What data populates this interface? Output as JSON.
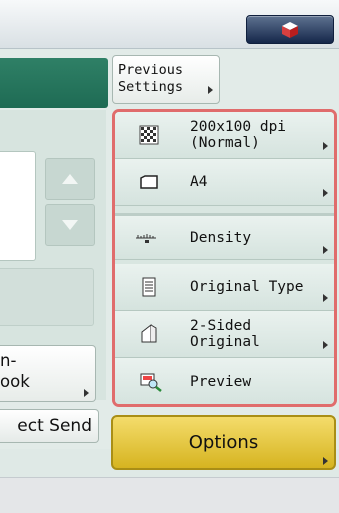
{
  "header": {
    "status_icon": "cube-monitor-icon"
  },
  "left_panel": {
    "address_book_line1": "n-",
    "address_book_line2": "ook",
    "direct_send_label": "ect Send"
  },
  "previous_settings": {
    "line1": "Previous",
    "line2": "Settings"
  },
  "settings": [
    {
      "line1": "200x100 dpi",
      "line2": "(Normal)",
      "icon": "resolution-icon"
    },
    {
      "line1": "A4",
      "line2": "",
      "icon": "paper-size-icon"
    },
    {
      "line1": "Density",
      "line2": "",
      "icon": "density-icon"
    },
    {
      "line1": "Original Type",
      "line2": "",
      "icon": "original-type-icon"
    },
    {
      "line1": "2-Sided",
      "line2": "Original",
      "icon": "two-sided-icon"
    },
    {
      "line1": "Preview",
      "line2": "",
      "icon": "preview-icon"
    }
  ],
  "options_label": "Options",
  "colors": {
    "highlight_border": "#e06c6c",
    "options_bg": "#e9c93c",
    "header_green": "#2a7a60"
  }
}
